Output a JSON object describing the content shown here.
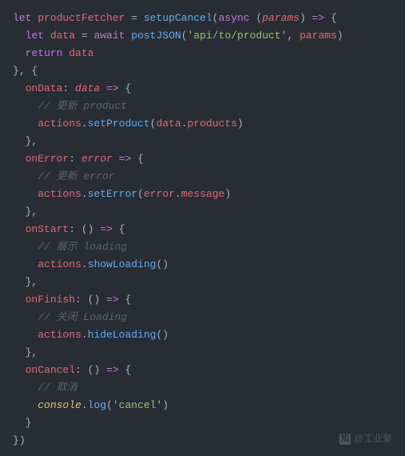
{
  "chart_data": {
    "type": "table",
    "title": "JavaScript code snippet — setupCancel async pattern",
    "language": "javascript",
    "code_text": "let productFetcher = setupCancel(async (params) => {\n  let data = await postJSON('api/to/product', params)\n  return data\n}, {\n  onData: data => {\n    // 更新 product\n    actions.setProduct(data.products)\n  },\n  onError: error => {\n    // 更新 error\n    actions.setError(error.message)\n  },\n  onStart: () => {\n    // 展示 loading\n    actions.showLoading()\n  },\n  onFinish: () => {\n    // 关闭 Loading\n    actions.hideLoading()\n  },\n  onCancel: () => {\n    // 取消\n    console.log('cancel')\n  }\n})"
  },
  "tokens": {
    "let": "let",
    "productFetcher": "productFetcher",
    "eq": " = ",
    "setupCancel": "setupCancel",
    "async": "async",
    "params": "params",
    "arrow": " => ",
    "data": "data",
    "await": "await",
    "postJSON": "postJSON",
    "apiStr": "'api/to/product'",
    "paramsRef": "params",
    "return": "return",
    "dataRef": "data",
    "onData": "onData",
    "dataParam": "data",
    "comment_product": "// 更新 product",
    "actions": "actions",
    "setProduct": "setProduct",
    "products": "products",
    "onError": "onError",
    "error": "error",
    "comment_error": "// 更新 error",
    "setError": "setError",
    "message": "message",
    "onStart": "onStart",
    "comment_loading": "// 展示 loading",
    "showLoading": "showLoading",
    "onFinish": "onFinish",
    "comment_close": "// 关闭 Loading",
    "hideLoading": "hideLoading",
    "onCancel": "onCancel",
    "comment_cancel": "// 取消",
    "console": "console",
    "log": "log",
    "cancelStr": "'cancel'"
  },
  "watermark": {
    "text": "@工业聚",
    "platform": "知乎"
  }
}
